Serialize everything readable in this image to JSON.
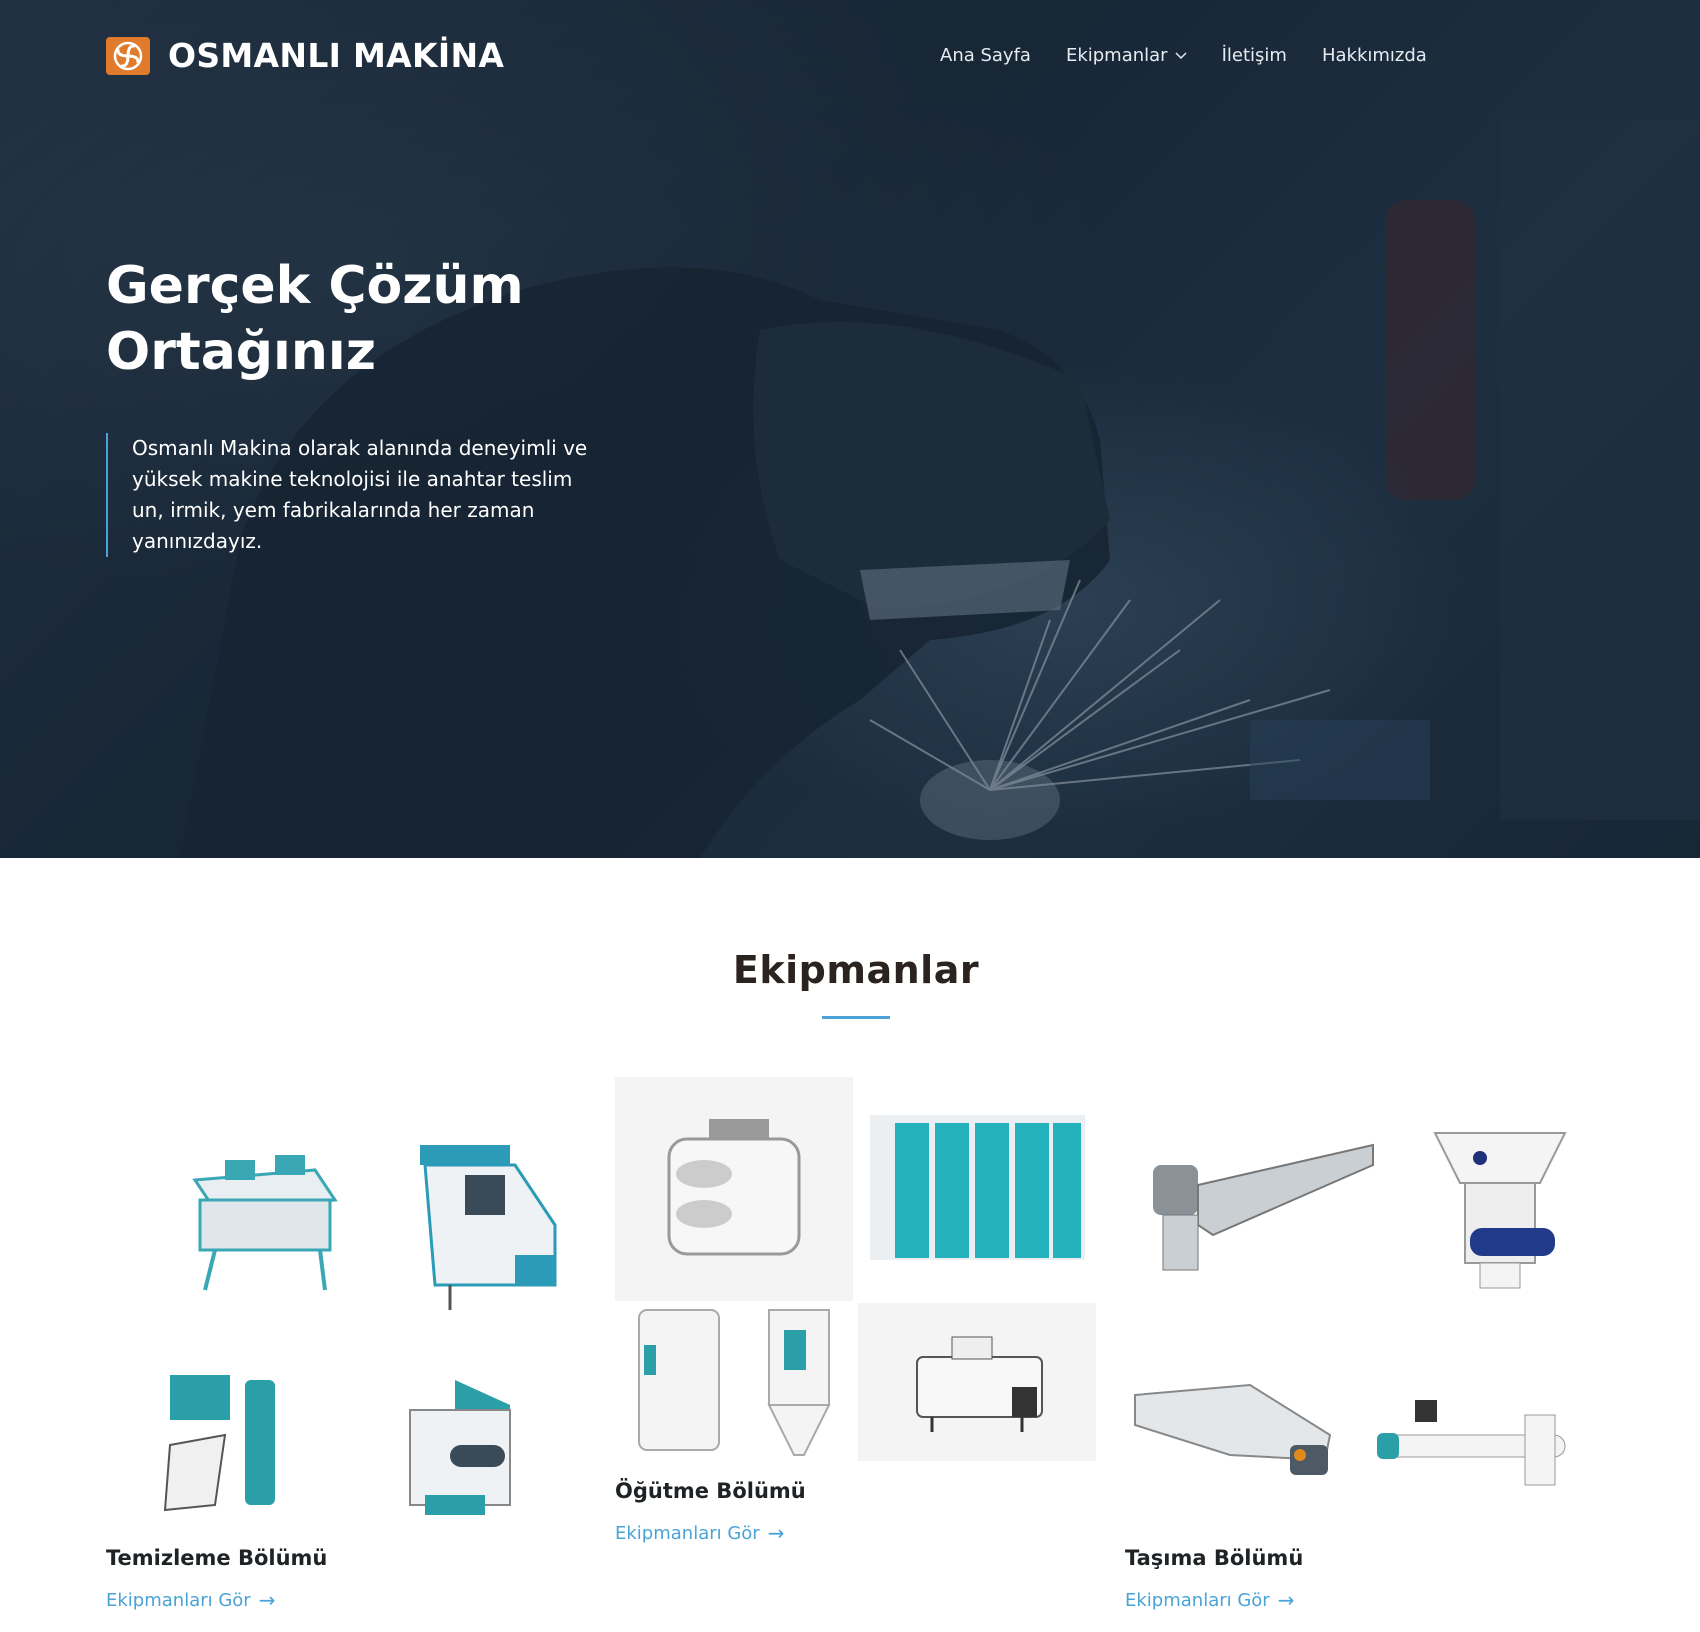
{
  "brand": {
    "name": "OSMANLI MAKİNA",
    "logo_icon": "fan-logo-icon",
    "logo_color": "#e07b2e"
  },
  "nav": {
    "items": [
      {
        "label": "Ana Sayfa"
      },
      {
        "label": "Ekipmanlar",
        "dropdown": true
      },
      {
        "label": "İletişim"
      },
      {
        "label": "Hakkımızda"
      }
    ]
  },
  "hero": {
    "title_line1": "Gerçek Çözüm",
    "title_line2": "Ortağınız",
    "text": "Osmanlı Makina olarak alanında deneyimli ve yüksek makine teknolojisi ile anahtar teslim un, irmik, yem fabrikalarında her zaman yanınızdayız."
  },
  "section": {
    "title": "Ekipmanlar",
    "accent_color": "#4aa3d6"
  },
  "cards": [
    {
      "title": "Temizleme Bölümü",
      "link": "Ekipmanları Gör",
      "arrow": "→"
    },
    {
      "title": "Öğütme Bölümü",
      "link": "Ekipmanları Gör",
      "arrow": "→"
    },
    {
      "title": "Taşıma Bölümü",
      "link": "Ekipmanları Gör",
      "arrow": "→"
    }
  ]
}
